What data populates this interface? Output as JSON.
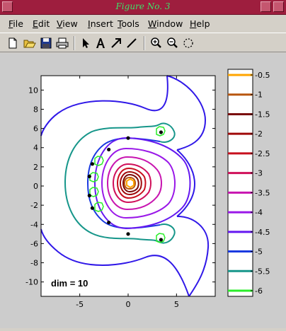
{
  "window": {
    "title": "Figure No. 3"
  },
  "menu": [
    {
      "label": "File",
      "u": "F",
      "rest": "ile"
    },
    {
      "label": "Edit",
      "u": "E",
      "rest": "dit"
    },
    {
      "label": "View",
      "u": "V",
      "rest": "iew"
    },
    {
      "label": "Insert",
      "u": "I",
      "rest": "nsert"
    },
    {
      "label": "Tools",
      "u": "T",
      "rest": "ools"
    },
    {
      "label": "Window",
      "u": "W",
      "rest": "indow"
    },
    {
      "label": "Help",
      "u": "H",
      "rest": "elp"
    }
  ],
  "toolbar": {
    "tools": [
      "new-figure-icon",
      "open-folder-icon",
      "save-icon",
      "print-icon",
      "select-arrow-icon",
      "text-tool-icon",
      "arrow-tool-icon",
      "line-tool-icon",
      "zoom-in-icon",
      "zoom-out-icon",
      "rotate-3d-icon"
    ]
  },
  "plot": {
    "annotation": "dim = 10",
    "x_ticks": [
      "-5",
      "0",
      "5"
    ],
    "y_ticks": [
      "10",
      "8",
      "6",
      "4",
      "2",
      "0",
      "-2",
      "-4",
      "-6",
      "-8",
      "-10"
    ]
  },
  "colorbar": {
    "labels": [
      "-0.5",
      "-1",
      "-1.5",
      "-2",
      "-2.5",
      "-3",
      "-3.5",
      "-4",
      "-4.5",
      "-5",
      "-5.5",
      "-6"
    ],
    "colors": [
      "#ffa500",
      "#b8560f",
      "#7a0a0a",
      "#a00a0a",
      "#c8101e",
      "#d0105a",
      "#c815b0",
      "#9a18e8",
      "#6418f0",
      "#1a3ae0",
      "#16968a",
      "#2aee2a"
    ]
  },
  "chart_data": {
    "type": "contour",
    "title": "",
    "xlabel": "",
    "ylabel": "",
    "xlim": [
      -9,
      9
    ],
    "ylim": [
      -11.5,
      11.5
    ],
    "levels": [
      -0.5,
      -1,
      -1.5,
      -2,
      -2.5,
      -3,
      -3.5,
      -4,
      -4.5,
      -5,
      -5.5,
      -6
    ],
    "points": [
      [
        -3.7,
        2.3
      ],
      [
        -4.0,
        1.0
      ],
      [
        -4.0,
        -1.0
      ],
      [
        -3.7,
        -2.3
      ],
      [
        -2.0,
        -3.8
      ],
      [
        0.0,
        -5.0
      ],
      [
        3.4,
        -5.6
      ],
      [
        3.4,
        5.6
      ],
      [
        0.0,
        5.0
      ],
      [
        -2.0,
        3.8
      ]
    ]
  }
}
